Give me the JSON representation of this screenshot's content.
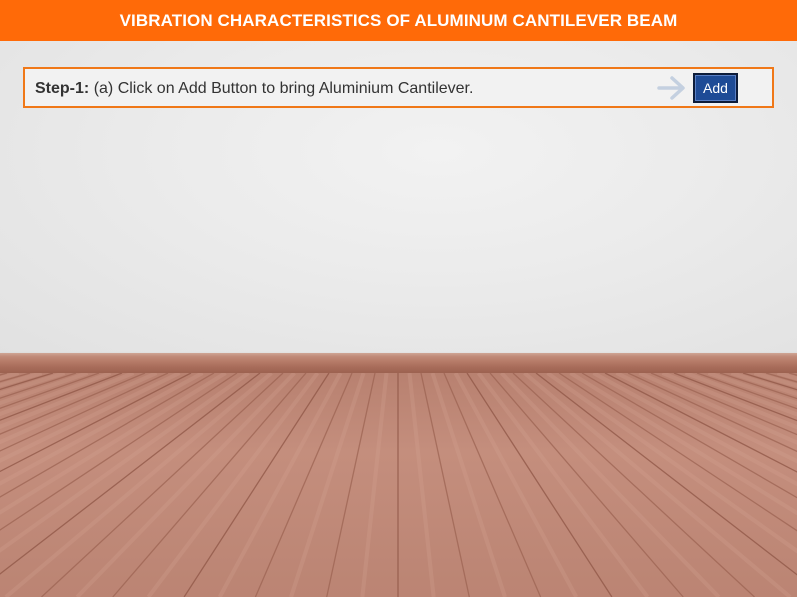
{
  "header": {
    "title": "VIBRATION CHARACTERISTICS OF ALUMINUM CANTILEVER BEAM"
  },
  "step": {
    "label": "Step-1:",
    "instruction": "(a) Click on Add Button to bring Aluminium Cantilever.",
    "arrow_icon": "arrow-right-icon",
    "add_button_label": "Add"
  },
  "colors": {
    "header_bg": "#ff6a08",
    "step_border": "#f07818",
    "add_button_bg": "#1e4b96",
    "arrow": "#c4d0e0"
  }
}
